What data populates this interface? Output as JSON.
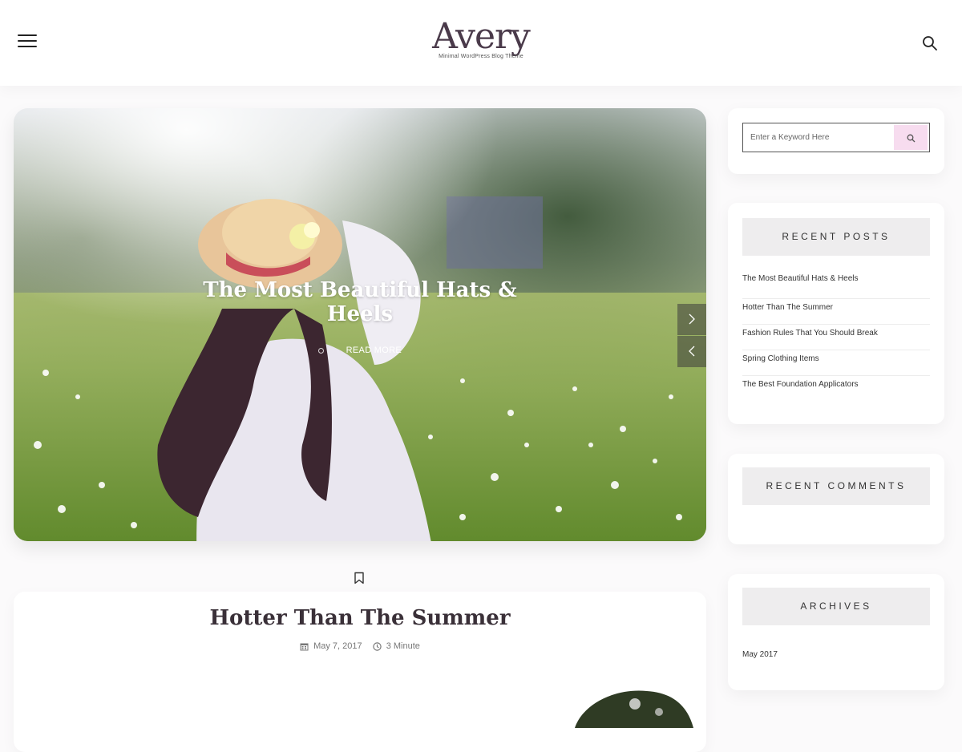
{
  "header": {
    "logo_word": "Avery",
    "logo_tagline": "Minimal WordPress Blog Theme"
  },
  "hero": {
    "title": "The Most Beautiful Hats & Heels",
    "read_more": "READ MORE"
  },
  "post": {
    "title": "Hotter Than The Summer",
    "date": "May 7, 2017",
    "read_time": "3 Minute"
  },
  "sidebar": {
    "search": {
      "placeholder": "Enter a Keyword Here"
    },
    "recent_posts": {
      "heading": "RECENT POSTS",
      "items": [
        "The Most Beautiful Hats & Heels",
        "Hotter Than The Summer",
        "Fashion Rules That You Should Break",
        "Spring Clothing Items",
        "The Best Foundation Applicators"
      ]
    },
    "recent_comments": {
      "heading": "RECENT COMMENTS"
    },
    "archives": {
      "heading": "ARCHIVES",
      "items": [
        "May 2017"
      ]
    }
  },
  "colors": {
    "accent_pink": "#f7dcef",
    "logo_plum": "#4a3a4a",
    "widget_heading_bg": "#eeedee",
    "page_bg": "#fbfafb"
  },
  "icons": [
    "hamburger-menu-icon",
    "search-icon",
    "chevron-right-icon",
    "chevron-left-icon",
    "bookmark-icon",
    "calendar-icon",
    "clock-icon"
  ]
}
